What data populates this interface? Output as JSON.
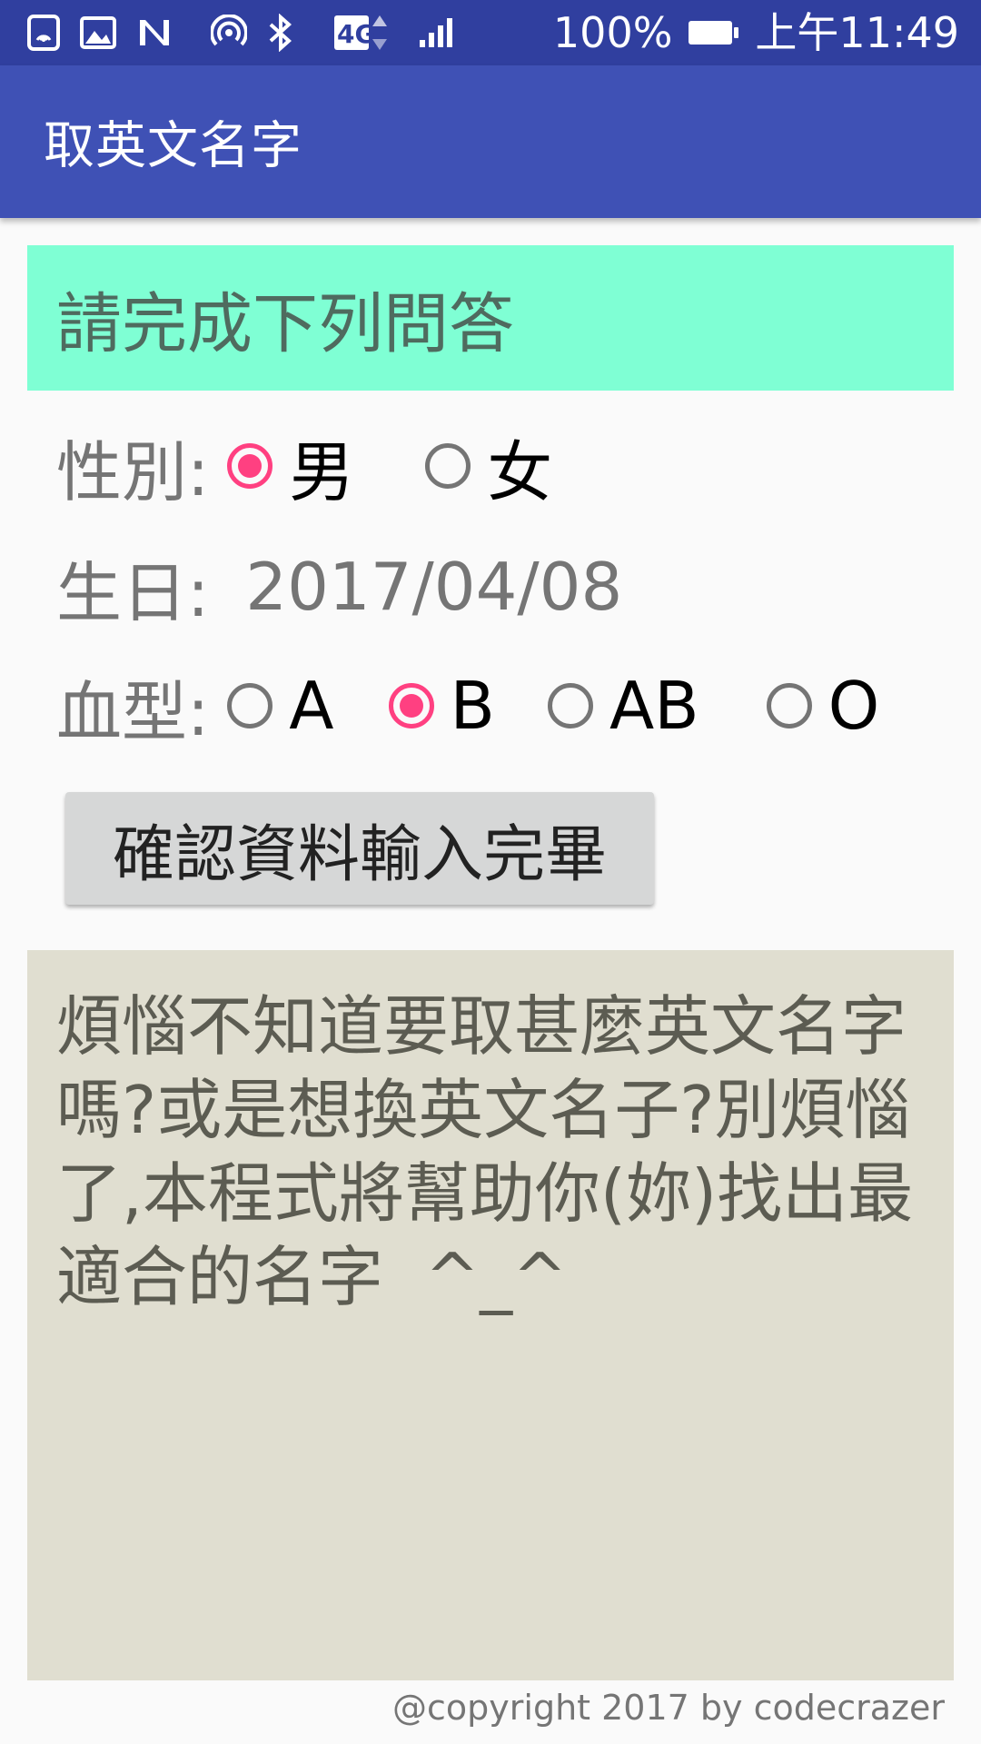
{
  "status_bar": {
    "battery_percent": "100%",
    "time": "上午11:49",
    "network_label": "4G",
    "icons": [
      "nfc-icon",
      "image-icon",
      "n-icon",
      "hotspot-icon",
      "bluetooth-icon",
      "network-4g-icon",
      "signal-icon",
      "battery-icon"
    ]
  },
  "app_bar": {
    "title": "取英文名字",
    "color": "#3F51B5"
  },
  "header": {
    "text": "請完成下列問答",
    "color": "#7FFFD4"
  },
  "form": {
    "gender": {
      "label": "性別:",
      "options": [
        {
          "label": "男",
          "checked": true
        },
        {
          "label": "女",
          "checked": false
        }
      ]
    },
    "birthday": {
      "label": "生日:",
      "value": "2017/04/08"
    },
    "blood_type": {
      "label": "血型:",
      "options": [
        {
          "label": "A",
          "checked": false
        },
        {
          "label": "B",
          "checked": true
        },
        {
          "label": "AB",
          "checked": false
        },
        {
          "label": "O",
          "checked": false
        }
      ]
    },
    "confirm_button": "確認資料輸入完畢"
  },
  "description": {
    "text": "煩惱不知道要取甚麼英文名字嗎?或是想換英文名子?別煩惱了,本程式將幫助你(妳)找出最適合的名字  ^_^",
    "color": "#E0DED0"
  },
  "footer": {
    "copyright": "@copyright 2017 by codecrazer"
  },
  "accent_color": "#FF4081"
}
